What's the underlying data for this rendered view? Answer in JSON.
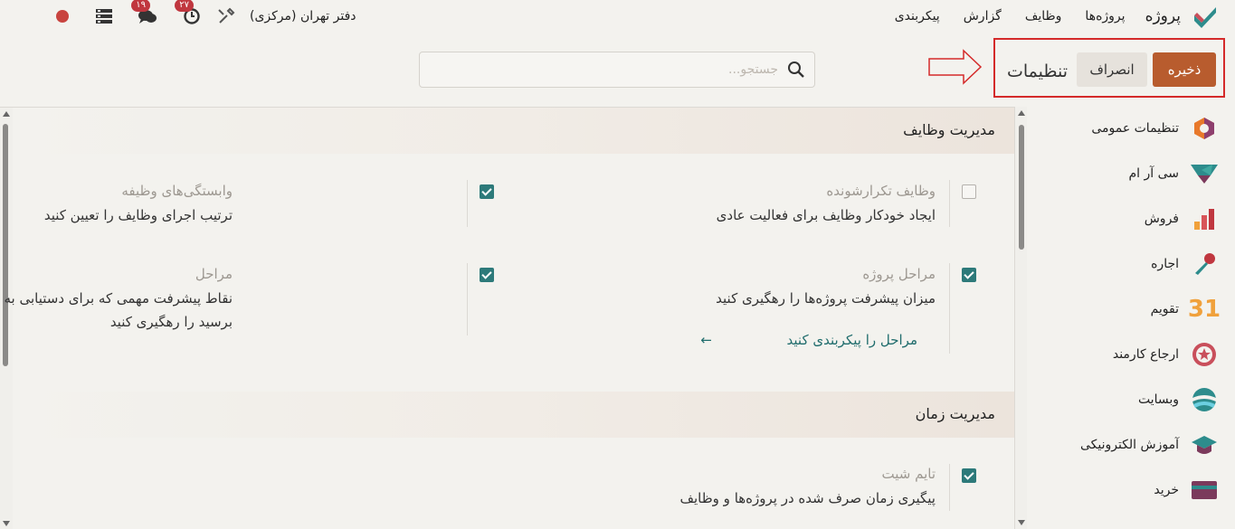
{
  "nav": {
    "brand": "پروژه",
    "items": [
      "پروژه‌ها",
      "وظایف",
      "گزارش",
      "پیکربندی"
    ],
    "company": "دفتر تهران (مرکزی)",
    "activity_badge": "۲۷",
    "messages_badge": "۱۹"
  },
  "control": {
    "title": "تنظیمات",
    "save_label": "ذخیره",
    "discard_label": "انصراف",
    "search_placeholder": "جستجو..."
  },
  "sidebar": {
    "items": [
      {
        "label": "تنظیمات عمومی",
        "icon": "settings-app-icon"
      },
      {
        "label": "سی آر ام",
        "icon": "crm-app-icon"
      },
      {
        "label": "فروش",
        "icon": "sales-app-icon"
      },
      {
        "label": "اجاره",
        "icon": "rental-app-icon"
      },
      {
        "label": "تقویم",
        "icon": "calendar-app-icon",
        "glyph": "31"
      },
      {
        "label": "ارجاع کارمند",
        "icon": "referral-app-icon"
      },
      {
        "label": "وبسایت",
        "icon": "website-app-icon"
      },
      {
        "label": "آموزش الکترونیکی",
        "icon": "elearning-app-icon"
      },
      {
        "label": "خرید",
        "icon": "purchase-app-icon"
      }
    ]
  },
  "sections": {
    "tasks": {
      "title": "مدیریت وظایف",
      "recurring": {
        "title": "وظایف تکرارشونده",
        "desc": "ایجاد خودکار وظایف برای فعالیت عادی",
        "checked": false
      },
      "dependencies": {
        "title": "وابستگی‌های وظیفه",
        "desc": "ترتیب اجرای وظایف را تعیین کنید",
        "checked": true
      },
      "stages": {
        "title": "مراحل پروژه",
        "desc": "میزان پیشرفت پروژه‌ها را رهگیری کنید",
        "link": "مراحل را پیکربندی کنید",
        "checked": true
      },
      "milestones": {
        "title": "مراحل",
        "desc": "نقاط پیشرفت مهمی که برای دستیابی به موفقیت باید به آن‌ها برسید را رهگیری کنید",
        "checked": true
      }
    },
    "time": {
      "title": "مدیریت زمان",
      "timesheet": {
        "title": "تایم شیت",
        "desc": "پیگیری زمان صرف شده در پروژه‌ها و وظایف",
        "checked": true
      }
    }
  },
  "colors": {
    "accent": "#b85c2e",
    "teal": "#2d7a7a",
    "annotation": "#d42a2a"
  }
}
